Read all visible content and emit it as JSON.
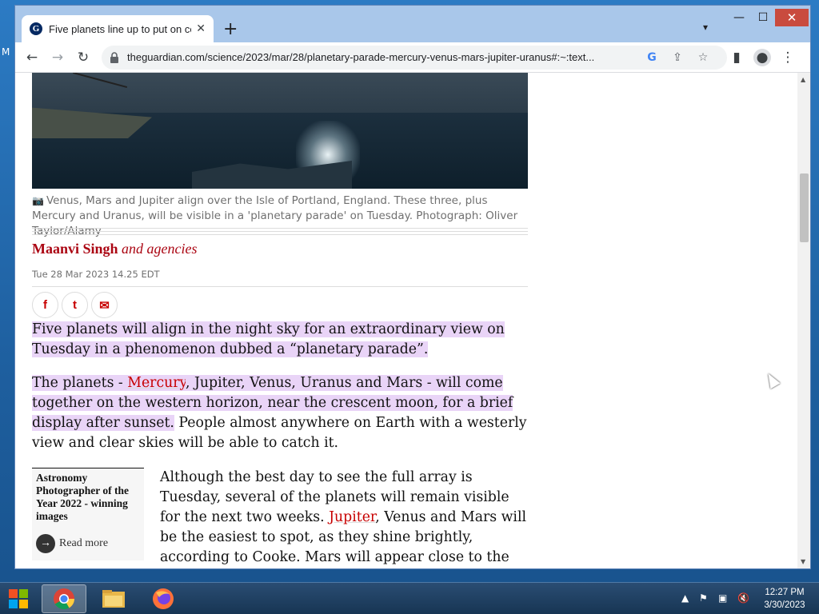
{
  "desktop": {
    "partial_letter": "M"
  },
  "browser": {
    "tab_title": "Five planets line up to put on cel",
    "favicon_letter": "G",
    "new_tab_symbol": "+",
    "url": "theguardian.com/science/2023/mar/28/planetary-parade-mercury-venus-mars-jupiter-uranus#:~:text...",
    "window_controls": {
      "minimize": "—",
      "maximize": "☐",
      "close": "✕"
    }
  },
  "article": {
    "caption": "Venus, Mars and Jupiter align over the Isle of Portland, England. These three, plus Mercury and Uranus, will be visible in a 'planetary parade' on Tuesday. Photograph: Oliver Taylor/Alamy",
    "author": "Maanvi Singh",
    "agencies": "and agencies",
    "dateline": "Tue 28 Mar 2023 14.25 EDT",
    "share": {
      "facebook": "f",
      "twitter": "t",
      "email": "✉"
    },
    "p1": "Five planets will align in the night sky for an extraordinary view on Tuesday in a phenomenon dubbed a “planetary parade”.",
    "p2_a": "The planets - ",
    "p2_link": "Mercury",
    "p2_b": ", Jupiter, Venus, Uranus and Mars - will come together on the western horizon, near the crescent moon, for a brief display after sunset.",
    "p2_c": " People almost anywhere on Earth with a westerly view and clear skies will be able to catch it.",
    "p3_a": "Although the best day to see the full array is Tuesday, several of the planets will remain visible for the next two weeks. ",
    "p3_link": "Jupiter",
    "p3_b": ", Venus and Mars will be the easiest to spot, as they shine brightly, according to Cooke. Mars will appear close to the moon, with a reddish glow, while",
    "rich_link": {
      "title": "Astronomy Photographer of the Year 2022 - winning images",
      "read_more": "Read more"
    }
  },
  "taskbar": {
    "time": "12:27 PM",
    "date": "3/30/2023"
  }
}
